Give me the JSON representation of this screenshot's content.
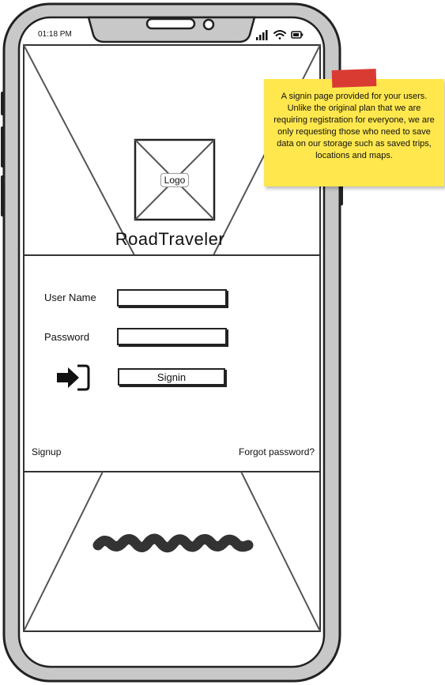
{
  "status_bar": {
    "time": "01:18 PM",
    "signal_icon": "signal-bars-icon",
    "wifi_icon": "wifi-icon",
    "battery_icon": "battery-icon"
  },
  "header": {
    "logo_label": "Logo",
    "app_title": "RoadTraveler"
  },
  "form": {
    "username_label": "User Name",
    "username_value": "",
    "password_label": "Password",
    "password_value": "",
    "signin_icon": "sign-in-arrow-icon",
    "signin_label": "Signin"
  },
  "links": {
    "signup": "Signup",
    "forgot_password": "Forgot password?"
  },
  "annotation": {
    "text": "A signin page provided for your users. Unlike the original plan that we are requiring registration for everyone, we are only requesting those who need to save data on our storage such as saved trips, locations and maps."
  },
  "colors": {
    "phone_frame": "#c8c8c8",
    "outline": "#222222",
    "sticky_note": "#ffe74d",
    "sticky_tape": "#d93b33"
  }
}
